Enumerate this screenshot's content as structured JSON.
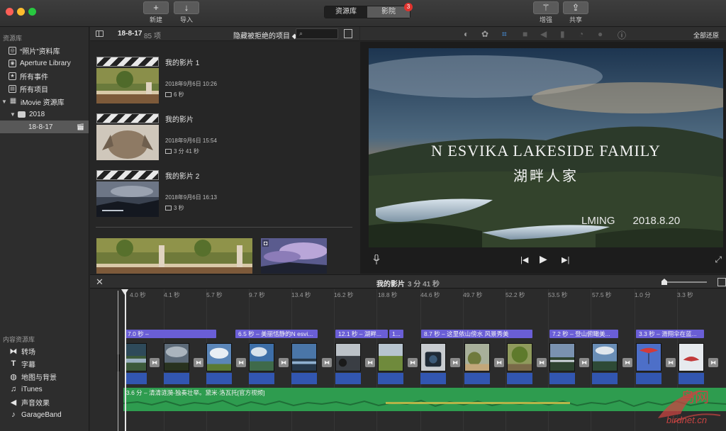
{
  "toolbar": {
    "new_label": "新建",
    "import_label": "导入",
    "tabs": [
      {
        "label": "资源库"
      },
      {
        "label": "影院"
      }
    ],
    "theater_badge": "3",
    "enhance_label": "增强",
    "share_label": "共享"
  },
  "sidebar": {
    "library_header": "资源库",
    "items": [
      {
        "label": "“照片”资料库",
        "icon": "photos-icon"
      },
      {
        "label": "Aperture Library",
        "icon": "aperture-icon"
      },
      {
        "label": "所有事件",
        "icon": "star-icon"
      },
      {
        "label": "所有项目",
        "icon": "film-icon"
      },
      {
        "label": "iMovie 资源库",
        "icon": "grid-icon"
      },
      {
        "label": "2018",
        "icon": "folder-icon"
      },
      {
        "label": "18-8-17",
        "icon": "clapper-icon"
      }
    ],
    "content_header": "内容资源库",
    "content_items": [
      {
        "label": "转场",
        "icon": "transitions-icon"
      },
      {
        "label": "字幕",
        "icon": "titles-icon"
      },
      {
        "label": "地图与背景",
        "icon": "globe-icon"
      },
      {
        "label": "iTunes",
        "icon": "music-note-icon"
      },
      {
        "label": "声音效果",
        "icon": "speaker-icon"
      },
      {
        "label": "GarageBand",
        "icon": "guitar-icon"
      }
    ]
  },
  "browser": {
    "event_name": "18-8-17",
    "item_count": "85 项",
    "filter": "隐藏被拒绝的项目 ◆",
    "projects": [
      {
        "title": "我的影片 1",
        "date": "2018年9月6日 10:26",
        "duration": "6 秒"
      },
      {
        "title": "我的影片",
        "date": "2018年9月6日 15:54",
        "duration": "3 分 41 秒"
      },
      {
        "title": "我的影片 2",
        "date": "2018年9月6日 16:13",
        "duration": "3 秒"
      }
    ]
  },
  "viewer": {
    "reset_all": "全部还原",
    "title_line1": "N ESVIKA LAKESIDE FAMILY",
    "title_line2": "湖畔人家",
    "title_line3": "LMING      2018.8.20"
  },
  "timeline": {
    "project_title": "我的影片",
    "project_duration": "3 分 41 秒",
    "ruler": [
      "4.0 秒",
      "4.1 秒",
      "5.7 秒",
      "9.7 秒",
      "13.4 秒",
      "16.2 秒",
      "18.8 秒",
      "44.6 秒",
      "49.7 秒",
      "52.2 秒",
      "53.5 秒",
      "57.5 秒",
      "1.0 分",
      "3.3 秒"
    ],
    "titles": [
      "7.0 秒 –",
      "6.5 秒 – 美丽恬静的N esvi...",
      "12.1 秒 – 湖畔...",
      "1...",
      "8.7 秒 – 这里依山傍水 风景秀美",
      "7.2 秒 – 登山俯瞰美...",
      "3.3 秒 – 滑翔伞在蓝..."
    ],
    "music_label": "3.6 分 – 清清涟漪-独奏壮举。黛米·洛瓦托[官方视频]"
  },
  "watermark": {
    "cn": "鸟网",
    "url": "birdnet.cn"
  }
}
